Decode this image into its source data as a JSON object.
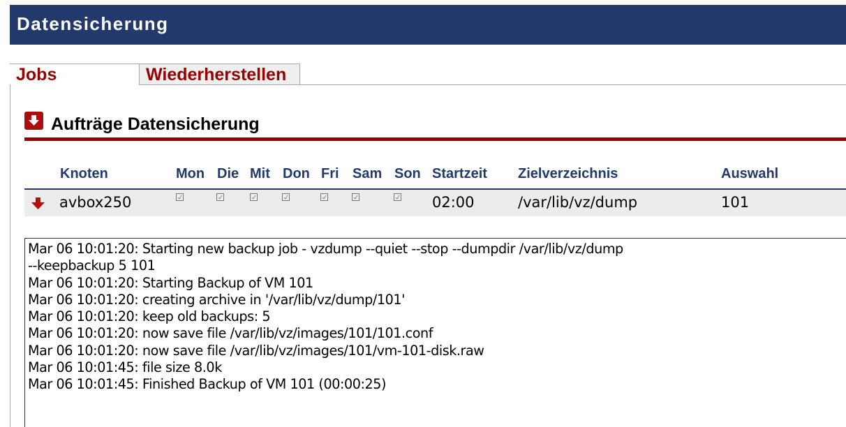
{
  "header": {
    "title": "Datensicherung"
  },
  "tabs": [
    {
      "label": "Jobs",
      "active": true
    },
    {
      "label": "Wiederherstellen",
      "active": false
    }
  ],
  "section": {
    "icon": "collapse-arrow-icon",
    "title": "Aufträge Datensicherung"
  },
  "table": {
    "columns": [
      "Knoten",
      "Mon",
      "Die",
      "Mit",
      "Don",
      "Fri",
      "Sam",
      "Son",
      "Startzeit",
      "Zielverzeichnis",
      "Auswahl"
    ],
    "rows": [
      {
        "icon": "red-down-arrow-icon",
        "node": "avbox250",
        "days": {
          "Mon": true,
          "Die": true,
          "Mit": true,
          "Don": true,
          "Fri": true,
          "Sam": true,
          "Son": true
        },
        "start_time": "02:00",
        "target_dir": "/var/lib/vz/dump",
        "selection": "101"
      }
    ]
  },
  "log": {
    "text": "Mar 06 10:01:20: Starting new backup job - vzdump --quiet --stop --dumpdir /var/lib/vz/dump\n--keepbackup 5 101\nMar 06 10:01:20: Starting Backup of VM 101\nMar 06 10:01:20: creating archive in '/var/lib/vz/dump/101'\nMar 06 10:01:20: keep old backups: 5\nMar 06 10:01:20: now save file /var/lib/vz/images/101/101.conf\nMar 06 10:01:20: now save file /var/lib/vz/images/101/vm-101-disk.raw\nMar 06 10:01:45: file size 8.0k\nMar 06 10:01:45: Finished Backup of VM 101 (00:00:25)"
  },
  "colors": {
    "header_bg": "#213a6b",
    "accent_red": "#990000",
    "column_header": "#213a6b",
    "row_bg": "#ececec"
  }
}
